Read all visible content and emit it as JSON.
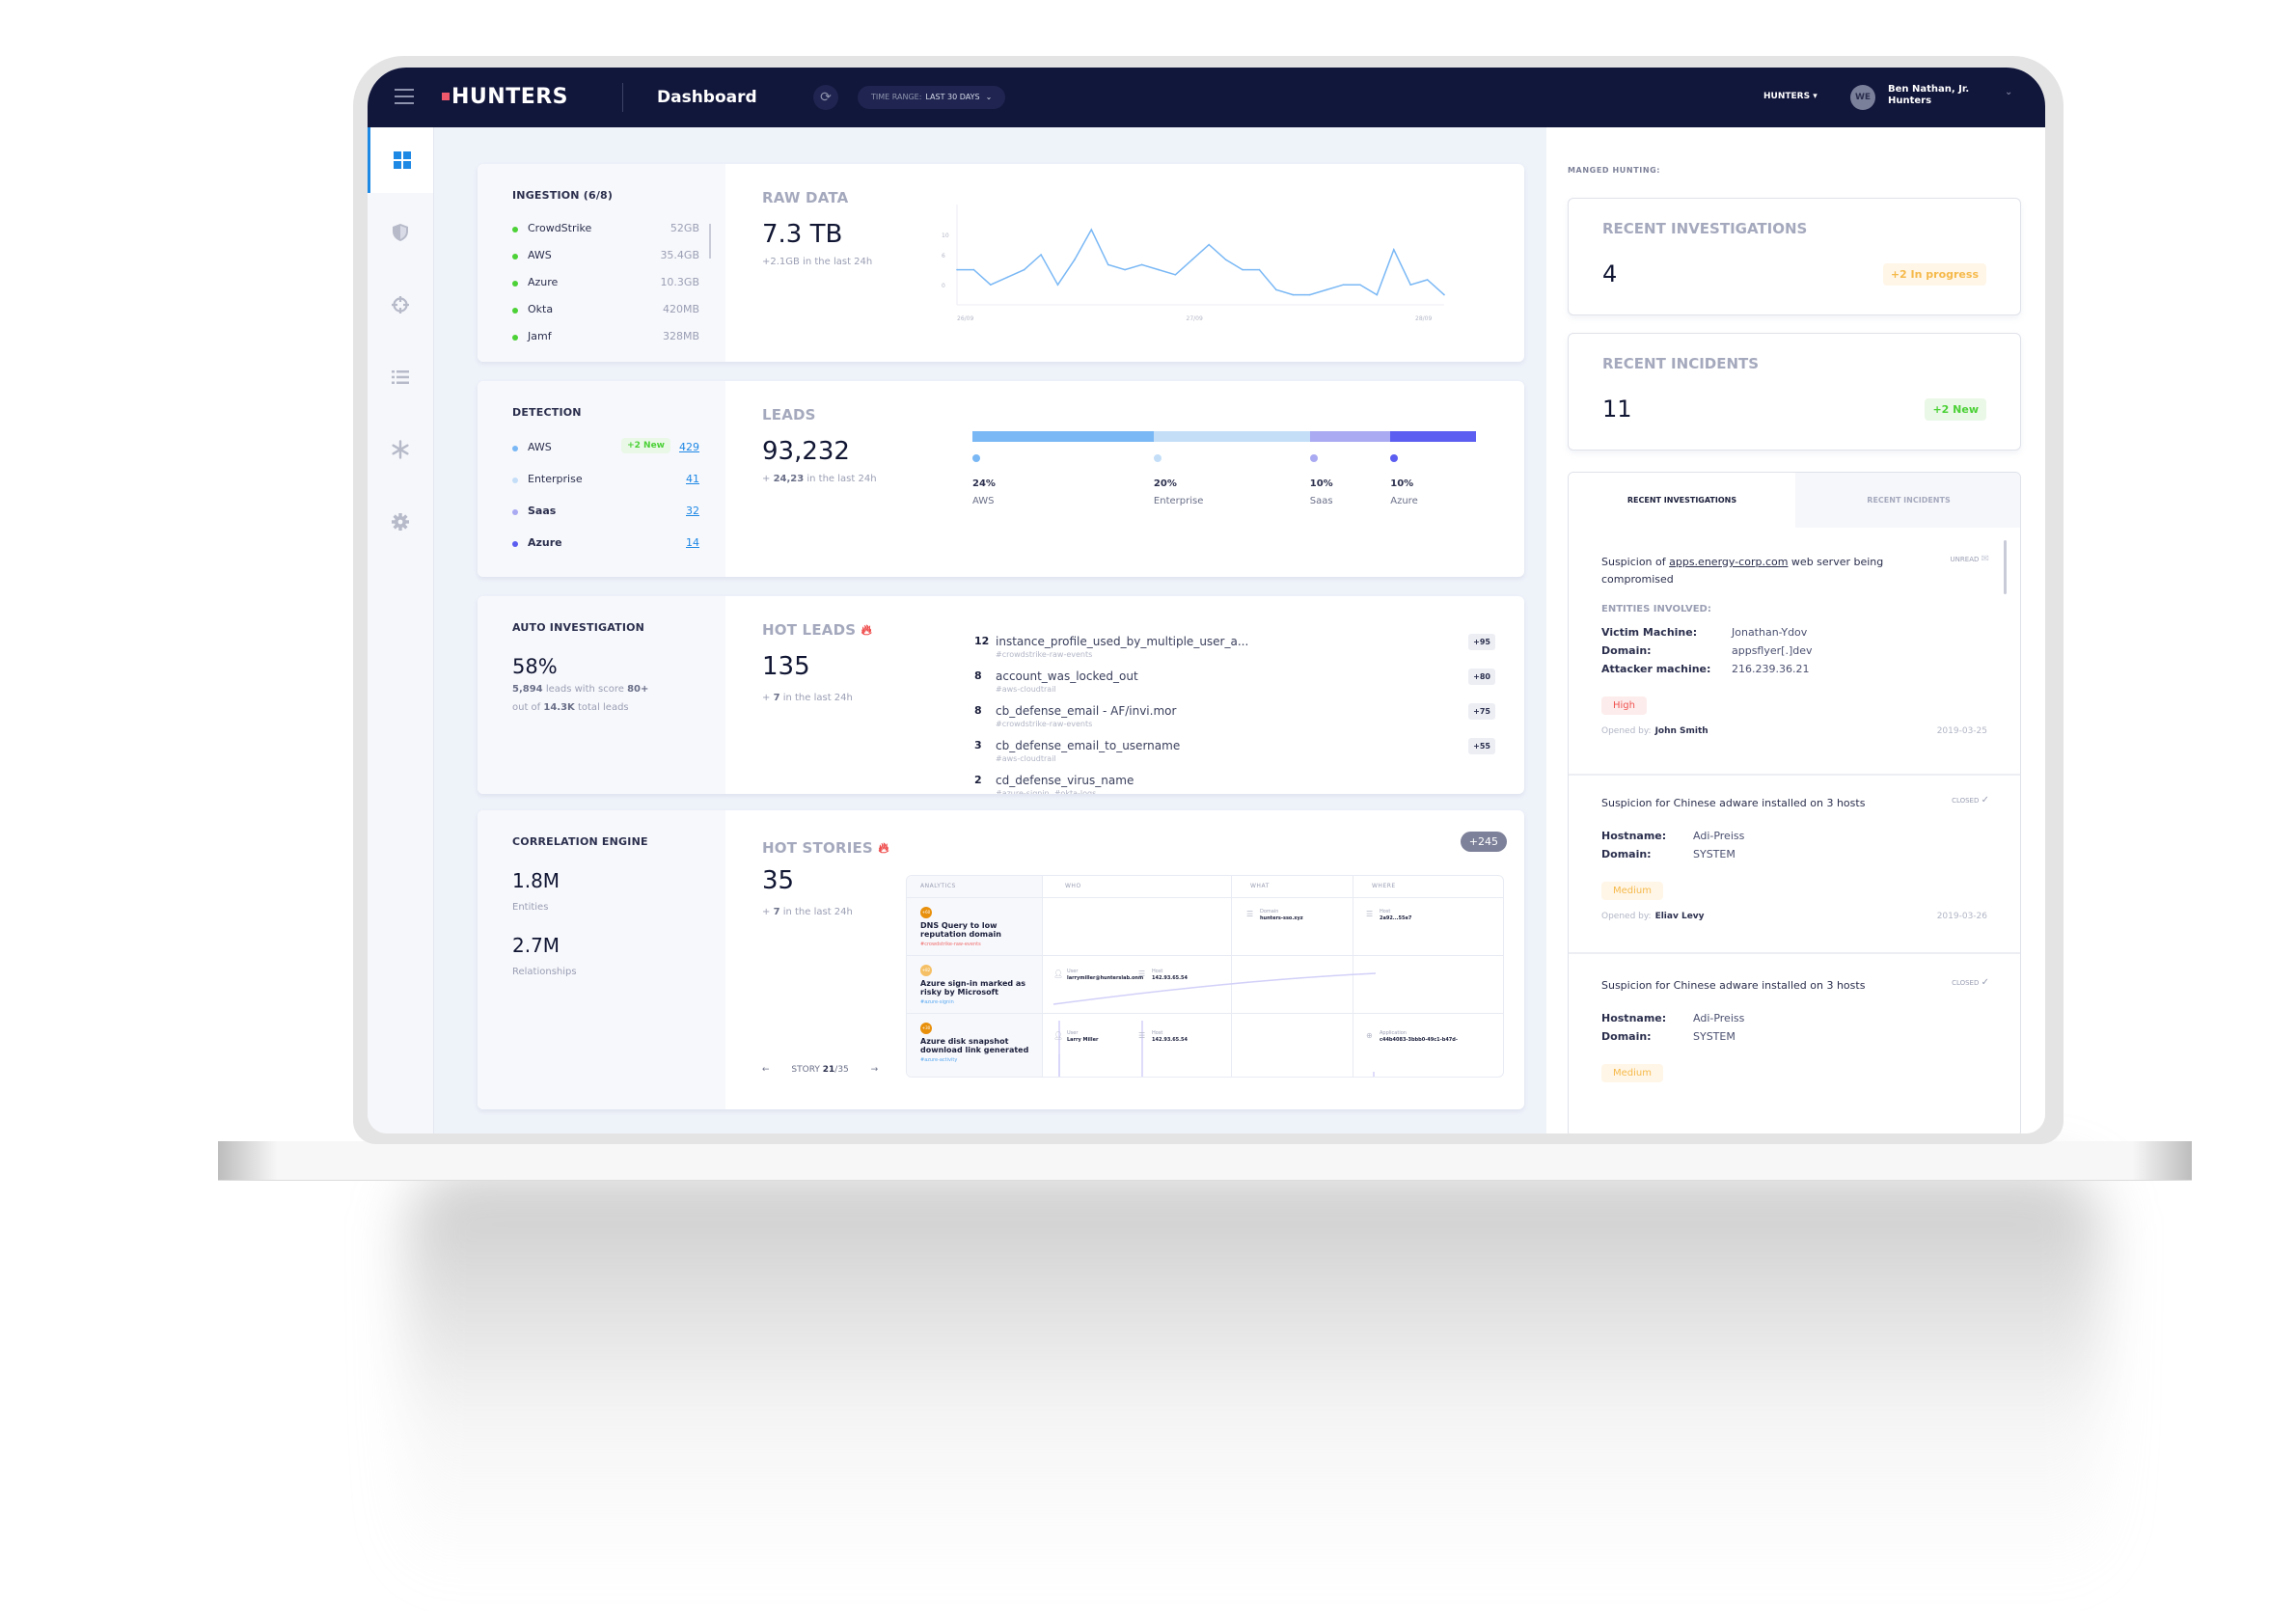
{
  "header": {
    "logo": "HUNTERS",
    "page_title": "Dashboard",
    "time_range_label": "TIME RANGE:",
    "time_range_value": "LAST 30 DAYS",
    "org": "HUNTERS",
    "avatar_initials": "WE",
    "user_name": "Ben Nathan, Jr.",
    "user_org": "Hunters"
  },
  "sidebar": {
    "items": [
      {
        "icon": "dashboard-grid-icon",
        "active": true
      },
      {
        "icon": "shield-icon",
        "active": false
      },
      {
        "icon": "crosshair-icon",
        "active": false
      },
      {
        "icon": "list-icon",
        "active": false
      },
      {
        "icon": "snowflake-icon",
        "active": false
      },
      {
        "icon": "gear-icon",
        "active": false
      }
    ]
  },
  "ingestion": {
    "title": "INGESTION (6/8)",
    "sources": [
      {
        "name": "CrowdStrike",
        "size": "52GB"
      },
      {
        "name": "AWS",
        "size": "35.4GB"
      },
      {
        "name": "Azure",
        "size": "10.3GB"
      },
      {
        "name": "Okta",
        "size": "420MB"
      },
      {
        "name": "Jamf",
        "size": "328MB"
      }
    ],
    "status_color": "#4cd137"
  },
  "raw_data": {
    "title": "RAW DATA",
    "value": "7.3 TB",
    "delta": "+2.1GB in the last 24h"
  },
  "chart_data": {
    "type": "line",
    "title": "RAW DATA",
    "xlabel": "",
    "ylabel": "",
    "x_ticks": [
      "26/09",
      "27/09",
      "28/09"
    ],
    "y_ticks": [
      "0",
      "6",
      "10"
    ],
    "ylim": [
      -4,
      16
    ],
    "grid": false,
    "series": [
      {
        "name": "raw data",
        "color": "#7ab8f5",
        "values": [
          3,
          3,
          0,
          1.5,
          3,
          6,
          0,
          5,
          11,
          4,
          3,
          4,
          3,
          2,
          5,
          8,
          5,
          3,
          3,
          -1,
          -2,
          -2,
          -1,
          0,
          0,
          -2,
          7,
          0,
          1,
          -2
        ]
      }
    ]
  },
  "detection": {
    "title": "DETECTION",
    "items": [
      {
        "name": "AWS",
        "count": "429",
        "badge": "+2 New",
        "color": "#7ab8f5",
        "bold": false
      },
      {
        "name": "Enterprise",
        "count": "41",
        "badge": null,
        "color": "#c4def8",
        "bold": false
      },
      {
        "name": "Saas",
        "count": "32",
        "badge": null,
        "color": "#a9aaf2",
        "bold": true
      },
      {
        "name": "Azure",
        "count": "14",
        "badge": null,
        "color": "#5b5ef0",
        "bold": true
      }
    ]
  },
  "leads": {
    "title": "LEADS",
    "value": "93,232",
    "delta_prefix": "+ ",
    "delta_value": "24,23",
    "delta_suffix": " in the last 24h",
    "segments": [
      {
        "label": "AWS",
        "pct": "24%",
        "share": 36,
        "color": "#7ab8f5"
      },
      {
        "label": "Enterprise",
        "pct": "20%",
        "share": 31,
        "color": "#c4def8"
      },
      {
        "label": "Saas",
        "pct": "10%",
        "share": 16,
        "color": "#a9aaf2"
      },
      {
        "label": "Azure",
        "pct": "10%",
        "share": 17,
        "color": "#5b5ef0"
      }
    ]
  },
  "auto_investigation": {
    "title": "AUTO INVESTIGATION",
    "value": "58%",
    "line1_num": "5,894",
    "line1_text": " leads with score ",
    "line1_score": "80+",
    "line2_text": "out of ",
    "line2_num": "14.3K",
    "line2_suffix": " total leads"
  },
  "hot_leads": {
    "title": "HOT LEADS",
    "value": "135",
    "delta_prefix": "+ ",
    "delta_value": "7",
    "delta_suffix": " in the last 24h",
    "items": [
      {
        "rank": "12",
        "name": "instance_profile_used_by_multiple_user_a...",
        "tag": "#crowdstrike-raw-events",
        "score": "+95"
      },
      {
        "rank": "8",
        "name": "account_was_locked_out",
        "tag": "#aws-cloudtrail",
        "score": "+80"
      },
      {
        "rank": "8",
        "name": "cb_defense_email - AF/invi.mor",
        "tag": "#crowdstrike-raw-events",
        "score": "+75"
      },
      {
        "rank": "3",
        "name": "cb_defense_email_to_username",
        "tag": "#aws-cloudtrail",
        "score": "+55"
      },
      {
        "rank": "2",
        "name": "cd_defense_virus_name",
        "tag": "#azure-signin, #okta-logs",
        "score": ""
      }
    ]
  },
  "correlation": {
    "title": "CORRELATION ENGINE",
    "entities_value": "1.8M",
    "entities_label": "Entities",
    "relationships_value": "2.7M",
    "relationships_label": "Relationships"
  },
  "hot_stories": {
    "title": "HOT STORIES",
    "value": "35",
    "delta_prefix": "+ ",
    "delta_value": "7",
    "delta_suffix": " in the last 24h",
    "badge": "+245",
    "nav_prefix": "STORY ",
    "nav_current": "21",
    "nav_total": "/35",
    "columns": [
      "ANALYTICS",
      "WHO",
      "WHAT",
      "WHERE"
    ],
    "rows": [
      {
        "score": "+60",
        "score_color": "#e8900c",
        "title": "DNS Query to low reputation domain",
        "tag": "#crowdstrike-raw-events",
        "tag_color": "#ef6b6b"
      },
      {
        "score": "+82",
        "score_color": "#f5c065",
        "title": "Azure sign-in marked as risky by Microsoft",
        "tag": "#azure-signin",
        "tag_color": "#5aa9f0"
      },
      {
        "score": "+30",
        "score_color": "#e8900c",
        "title": "Azure disk snapshot download link generated",
        "tag": "#azure-activity",
        "tag_color": "#5aa9f0"
      }
    ],
    "entities": [
      {
        "k": "Domain",
        "v": "hunters-sso.xyz"
      },
      {
        "k": "Host",
        "v": "2a92...55e7"
      },
      {
        "k": "User",
        "v": "larrymiller@hunterslab.onm"
      },
      {
        "k": "Host",
        "v": "142.93.65.54"
      },
      {
        "k": "User",
        "v": "Larry Miller"
      },
      {
        "k": "Host",
        "v": "142.93.65.54"
      },
      {
        "k": "Application",
        "v": "c44b4083-3bbb0-49c1-b47d-"
      }
    ]
  },
  "managed_hunting": {
    "label": "MANGED HUNTING:",
    "recent_investigations": {
      "title": "RECENT INVESTIGATIONS",
      "value": "4",
      "badge": "+2 In progress"
    },
    "recent_incidents": {
      "title": "RECENT INCIDENTS",
      "value": "11",
      "badge": "+2 New"
    },
    "tabs": [
      "RECENT INVESTIGATIONS",
      "RECENT INCIDENTS"
    ],
    "investigations": [
      {
        "title_prefix": "Suspicion of ",
        "title_link": "apps.energy-corp.com",
        "title_suffix": " web server being compromised",
        "status": "UNREAD",
        "entities_header": "ENTITIES INVOLVED:",
        "fields": [
          {
            "k": "Victim Machine:",
            "v": "Jonathan-Ydov"
          },
          {
            "k": "Domain:",
            "v": "appsflyer[.]dev"
          },
          {
            "k": "Attacker machine:",
            "v": "216.239.36.21"
          }
        ],
        "severity": "High",
        "opened_by_label": "Opened by:",
        "opened_by": "John Smith",
        "date": "2019-03-25"
      },
      {
        "title": "Suspicion for Chinese adware installed on 3 hosts",
        "status": "CLOSED",
        "fields": [
          {
            "k": "Hostname:",
            "v": "Adi-Preiss"
          },
          {
            "k": "Domain:",
            "v": "SYSTEM"
          }
        ],
        "severity": "Medium",
        "opened_by_label": "Opened by:",
        "opened_by": "Eliav Levy",
        "date": "2019-03-26"
      },
      {
        "title": "Suspicion for Chinese adware installed on 3 hosts",
        "status": "CLOSED",
        "fields": [
          {
            "k": "Hostname:",
            "v": "Adi-Preiss"
          },
          {
            "k": "Domain:",
            "v": "SYSTEM"
          }
        ],
        "severity": "Medium"
      }
    ]
  },
  "colors": {
    "header_bg": "#11163b",
    "accent": "#1e88e5",
    "positive": "#4cd137",
    "warning": "#f5b94a",
    "danger": "#ef5350",
    "fire": "#ef4b4b"
  }
}
